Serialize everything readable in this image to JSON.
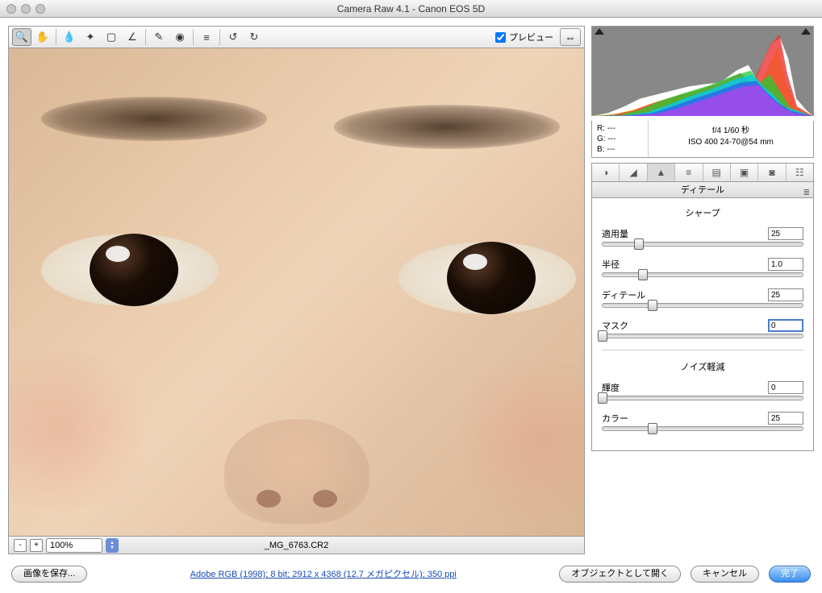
{
  "window": {
    "title": "Camera Raw 4.1  -  Canon EOS 5D"
  },
  "toolbar": {
    "preview_label": "プレビュー",
    "preview_checked": true
  },
  "zoom": {
    "minus": "-",
    "plus": "+",
    "value": "100%"
  },
  "filename": "_MG_6763.CR2",
  "rgb": {
    "r_label": "R:",
    "g_label": "G:",
    "b_label": "B:",
    "r": "---",
    "g": "---",
    "b": "---"
  },
  "exif": {
    "line1": "f/4    1/60 秒",
    "line2": "ISO 400    24-70@54 mm"
  },
  "panel": {
    "title": "ディテール"
  },
  "sharpen": {
    "title": "シャープ",
    "amount": {
      "label": "適用量",
      "value": "25",
      "pos": 18
    },
    "radius": {
      "label": "半径",
      "value": "1.0",
      "pos": 20
    },
    "detail": {
      "label": "ディテール",
      "value": "25",
      "pos": 25
    },
    "mask": {
      "label": "マスク",
      "value": "0",
      "pos": 0
    }
  },
  "noise": {
    "title": "ノイズ軽減",
    "luminance": {
      "label": "輝度",
      "value": "0",
      "pos": 0
    },
    "color": {
      "label": "カラー",
      "value": "25",
      "pos": 25
    }
  },
  "footer": {
    "save": "画像を保存...",
    "link": "Adobe RGB (1998); 8 bit; 2912 x 4368 (12.7 メガピクセル); 350 ppi",
    "open": "オブジェクトとして開く",
    "cancel": "キャンセル",
    "done": "完了"
  }
}
